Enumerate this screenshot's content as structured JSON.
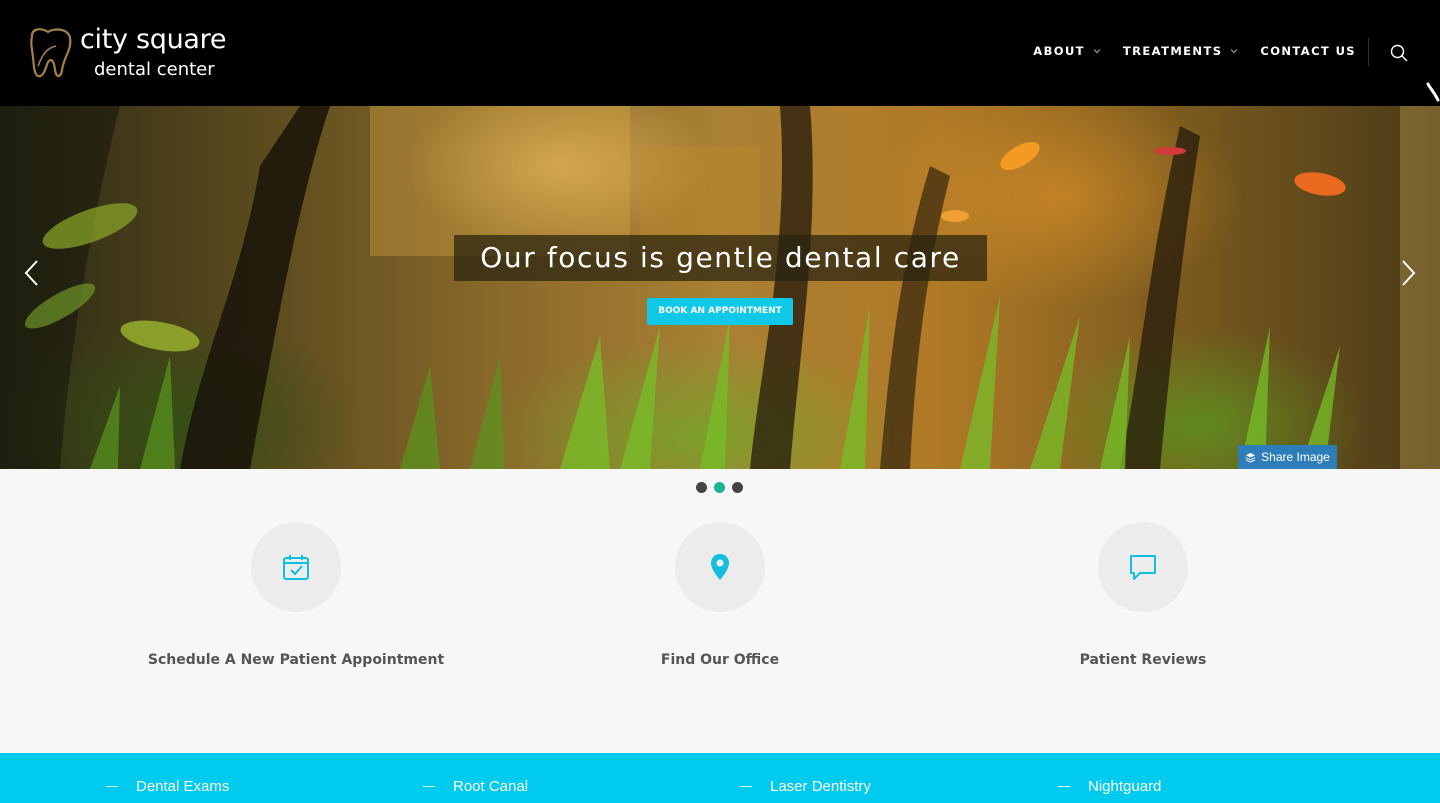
{
  "header": {
    "logo": {
      "line1": "city square",
      "line2": "dental center"
    },
    "nav": [
      {
        "label": "ABOUT",
        "has_dropdown": true
      },
      {
        "label": "TREATMENTS",
        "has_dropdown": true
      },
      {
        "label": "CONTACT US",
        "has_dropdown": false
      }
    ],
    "search_icon": "search-icon"
  },
  "hero": {
    "title": "Our focus is gentle dental care",
    "cta_label": "BOOK AN APPOINTMENT",
    "share_label": "Share Image",
    "prev_icon": "chevron-left-icon",
    "next_icon": "chevron-right-icon",
    "slides": 3,
    "active_slide": 2
  },
  "features": [
    {
      "label": "Schedule A New Patient Appointment",
      "icon": "calendar-check-icon"
    },
    {
      "label": "Find Our Office",
      "icon": "map-pin-icon"
    },
    {
      "label": "Patient Reviews",
      "icon": "chat-bubble-icon"
    }
  ],
  "treatments": [
    {
      "label": "Dental Exams"
    },
    {
      "label": "Root Canal"
    },
    {
      "label": "Laser Dentistry"
    },
    {
      "label": "Nightguard"
    }
  ],
  "colors": {
    "accent": "#00cbee",
    "cta": "#10c8e8",
    "active_dot": "#1ab394",
    "share": "#2d7db8",
    "header_bg": "#000000"
  }
}
